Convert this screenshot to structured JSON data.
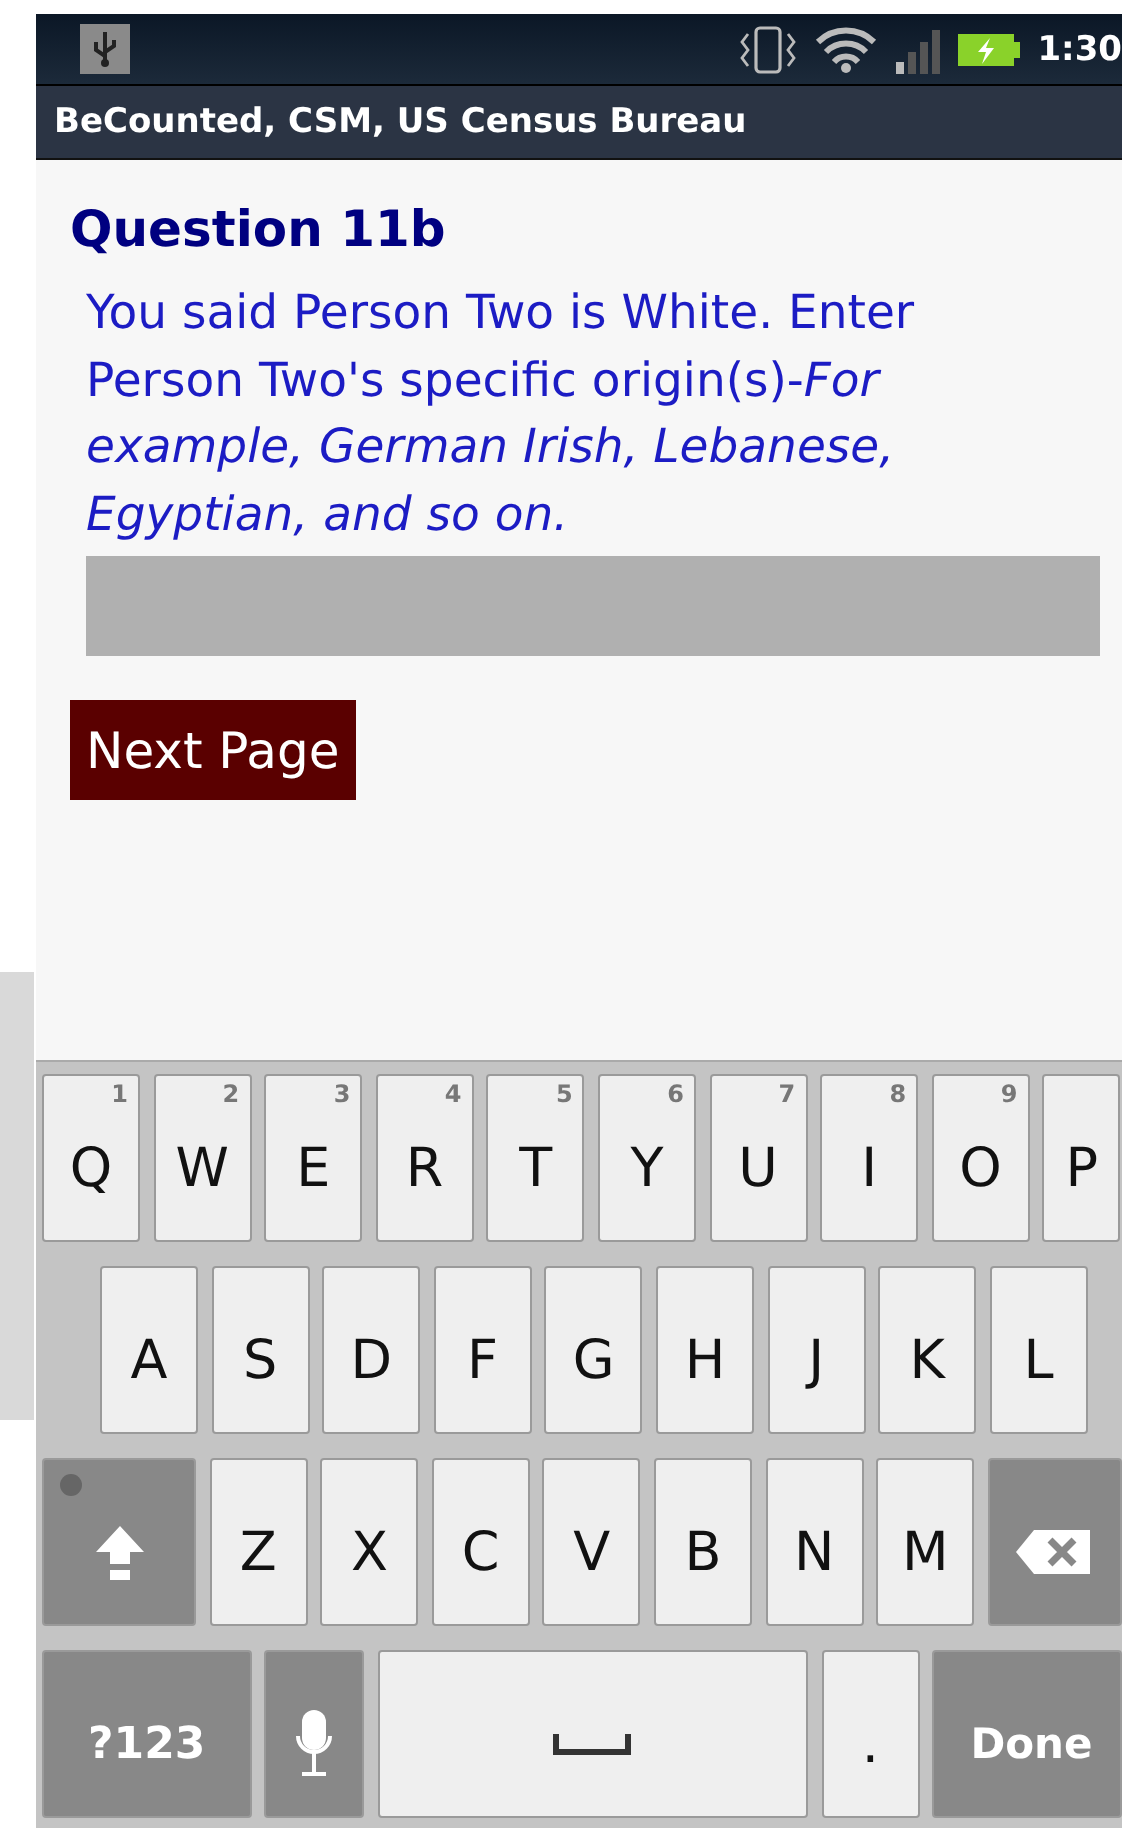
{
  "status_bar": {
    "time": "1:30"
  },
  "app_bar": {
    "title": "BeCounted, CSM, US Census Bureau"
  },
  "question": {
    "title": "Question 11b",
    "prompt": "You said Person Two is White. Enter Person Two's specific origin(s)-*For example, German Irish, Lebanese, Egyptian, and so on.*"
  },
  "next_button": {
    "label": "Next Page"
  },
  "keyboard": {
    "rows": [
      {
        "keys": [
          {
            "kind": "letter",
            "label": "Q",
            "hint": "1"
          },
          {
            "kind": "letter",
            "label": "W",
            "hint": "2"
          },
          {
            "kind": "letter",
            "label": "E",
            "hint": "3"
          },
          {
            "kind": "letter",
            "label": "R",
            "hint": "4"
          },
          {
            "kind": "letter",
            "label": "T",
            "hint": "5"
          },
          {
            "kind": "letter",
            "label": "Y",
            "hint": "6"
          },
          {
            "kind": "letter",
            "label": "U",
            "hint": "7"
          },
          {
            "kind": "letter",
            "label": "I",
            "hint": "8"
          },
          {
            "kind": "letter",
            "label": "O",
            "hint": "9"
          },
          {
            "kind": "letter",
            "label": "P"
          }
        ]
      },
      {
        "keys": [
          {
            "kind": "letter",
            "label": "A"
          },
          {
            "kind": "letter",
            "label": "S"
          },
          {
            "kind": "letter",
            "label": "D"
          },
          {
            "kind": "letter",
            "label": "F"
          },
          {
            "kind": "letter",
            "label": "G"
          },
          {
            "kind": "letter",
            "label": "H"
          },
          {
            "kind": "letter",
            "label": "J"
          },
          {
            "kind": "letter",
            "label": "K"
          },
          {
            "kind": "letter",
            "label": "L"
          }
        ]
      },
      {
        "keys": [
          {
            "kind": "shift"
          },
          {
            "kind": "letter",
            "label": "Z"
          },
          {
            "kind": "letter",
            "label": "X"
          },
          {
            "kind": "letter",
            "label": "C"
          },
          {
            "kind": "letter",
            "label": "V"
          },
          {
            "kind": "letter",
            "label": "B"
          },
          {
            "kind": "letter",
            "label": "N"
          },
          {
            "kind": "letter",
            "label": "M"
          },
          {
            "kind": "backspace"
          }
        ]
      },
      {
        "keys": [
          {
            "kind": "symbols",
            "label": "?123"
          },
          {
            "kind": "mic"
          },
          {
            "kind": "space"
          },
          {
            "kind": "period",
            "label": "."
          },
          {
            "kind": "done",
            "label": "Done"
          }
        ]
      }
    ]
  }
}
